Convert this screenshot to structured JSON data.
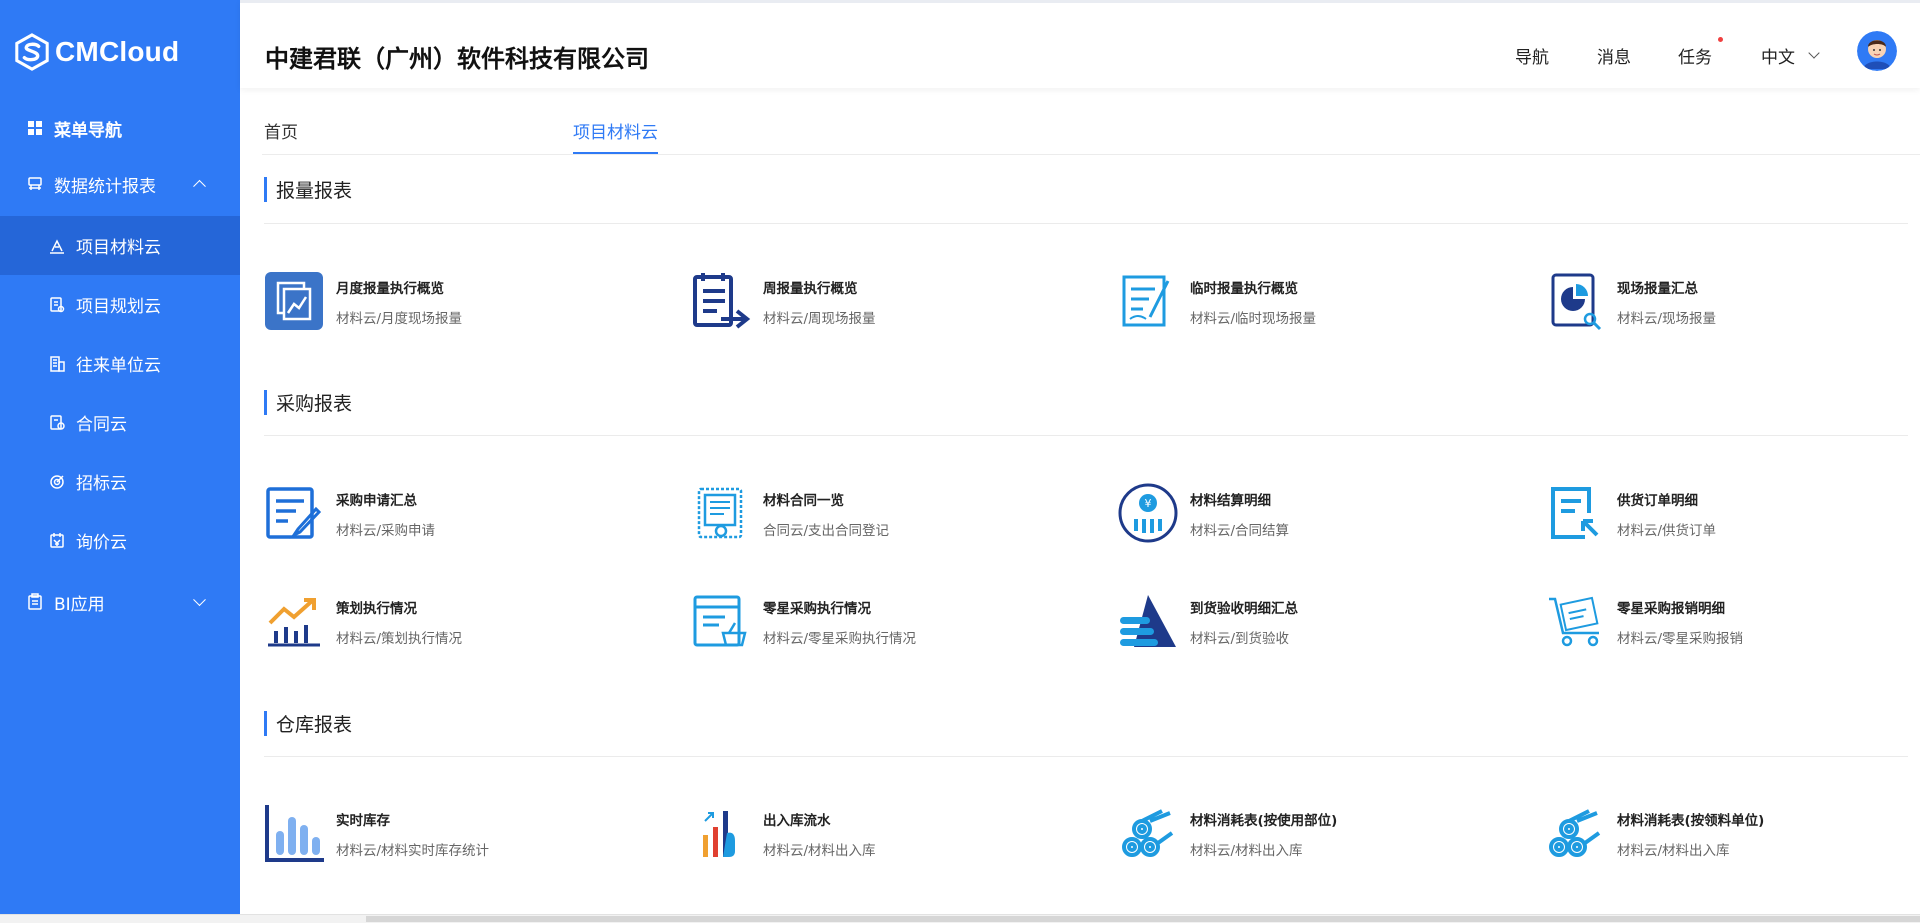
{
  "brand": {
    "logo_text": "CMCloud"
  },
  "sidebar": {
    "menu_nav": "菜单导航",
    "stats_group": "数据统计报表",
    "items": [
      {
        "label": "项目材料云",
        "active": true
      },
      {
        "label": "项目规划云"
      },
      {
        "label": "往来单位云"
      },
      {
        "label": "合同云"
      },
      {
        "label": "招标云"
      },
      {
        "label": "询价云"
      }
    ],
    "bi_group": "BI应用"
  },
  "header": {
    "company": "中建君联（广州）软件科技有限公司",
    "nav": "导航",
    "messages": "消息",
    "tasks": "任务",
    "language": "中文"
  },
  "tabs": [
    {
      "label": "首页"
    },
    {
      "label": "项目材料云",
      "active": true
    }
  ],
  "sections": [
    {
      "title": "报量报表",
      "cards": [
        {
          "title": "月度报量执行概览",
          "subtitle": "材料云/月度现场报量",
          "icon": "monthly-report-icon"
        },
        {
          "title": "周报量执行概览",
          "subtitle": "材料云/周现场报量",
          "icon": "weekly-report-icon"
        },
        {
          "title": "临时报量执行概览",
          "subtitle": "材料云/临时现场报量",
          "icon": "temporary-report-icon"
        },
        {
          "title": "现场报量汇总",
          "subtitle": "材料云/现场报量",
          "icon": "site-summary-icon"
        }
      ]
    },
    {
      "title": "采购报表",
      "cards": [
        {
          "title": "采购申请汇总",
          "subtitle": "材料云/采购申请",
          "icon": "purchase-request-icon"
        },
        {
          "title": "材料合同一览",
          "subtitle": "合同云/支出合同登记",
          "icon": "contract-list-icon"
        },
        {
          "title": "材料结算明细",
          "subtitle": "材料云/合同结算",
          "icon": "settlement-icon"
        },
        {
          "title": "供货订单明细",
          "subtitle": "材料云/供货订单",
          "icon": "supply-order-icon"
        },
        {
          "title": "策划执行情况",
          "subtitle": "材料云/策划执行情况",
          "icon": "plan-execution-icon"
        },
        {
          "title": "零星采购执行情况",
          "subtitle": "材料云/零星采购执行情况",
          "icon": "sporadic-purchase-icon"
        },
        {
          "title": "到货验收明细汇总",
          "subtitle": "材料云/到货验收",
          "icon": "arrival-acceptance-icon"
        },
        {
          "title": "零星采购报销明细",
          "subtitle": "材料云/零星采购报销",
          "icon": "reimbursement-icon"
        }
      ]
    },
    {
      "title": "仓库报表",
      "cards": [
        {
          "title": "实时库存",
          "subtitle": "材料云/材料实时库存统计",
          "icon": "realtime-inventory-icon"
        },
        {
          "title": "出入库流水",
          "subtitle": "材料云/材料出入库",
          "icon": "inout-flow-icon"
        },
        {
          "title": "材料消耗表(按使用部位)",
          "subtitle": "材料云/材料出入库",
          "icon": "consumption-by-location-icon"
        },
        {
          "title": "材料消耗表(按领料单位)",
          "subtitle": "材料云/材料出入库",
          "icon": "consumption-by-unit-icon"
        }
      ]
    }
  ],
  "colors": {
    "sidebar_bg": "#2f7af5",
    "sidebar_active": "#2566d8",
    "accent": "#2f7af5",
    "icon_dark": "#1e3a8a",
    "icon_light": "#1e9be0",
    "icon_orange": "#f0a030",
    "notify_dot": "#f04040"
  }
}
